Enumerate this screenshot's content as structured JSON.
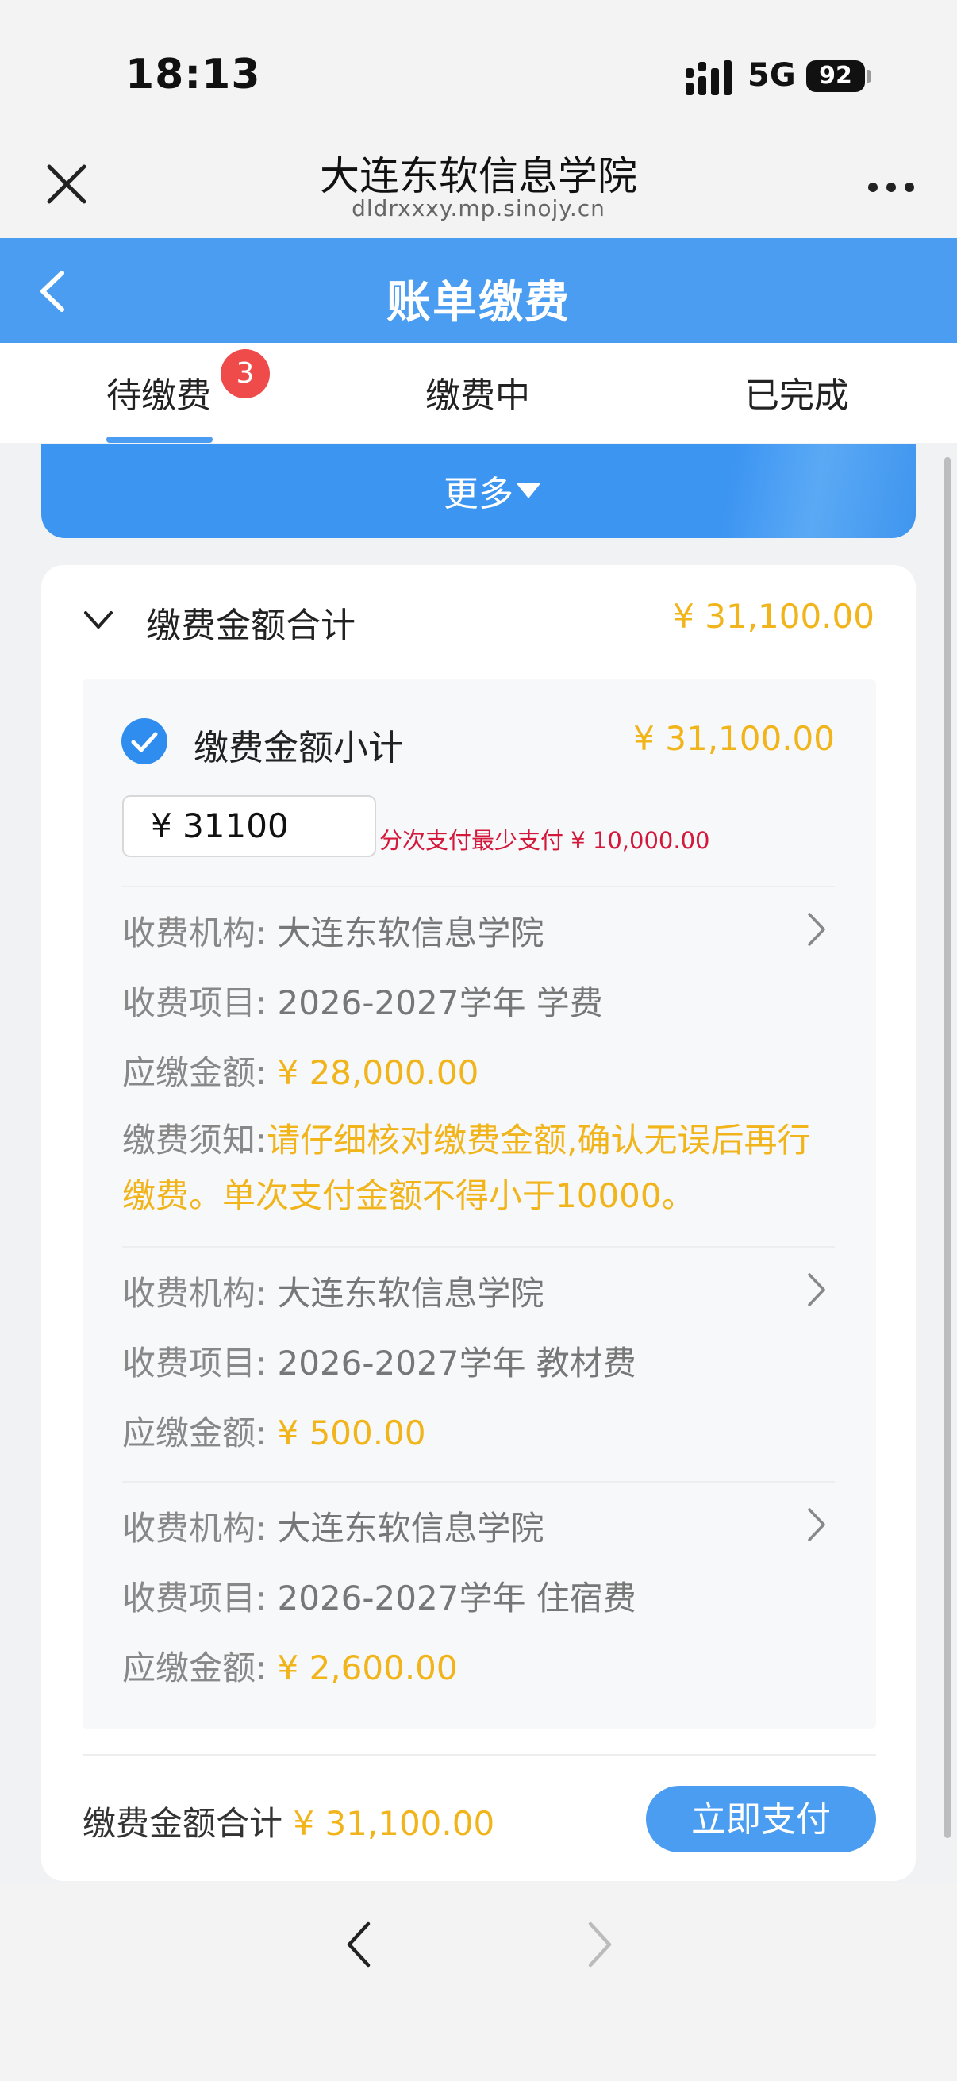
{
  "status_bar": {
    "time": "18:13",
    "network": "5G",
    "battery": "92",
    "signal_icon": "signal-bars-icon"
  },
  "browser": {
    "title": "大连东软信息学院",
    "url": "dldrxxxy.mp.sinojy.cn",
    "close_icon": "close-icon",
    "more_icon": "more-dots-icon"
  },
  "header": {
    "title": "账单缴费",
    "back_icon": "back-arrow-icon"
  },
  "tabs": [
    {
      "label": "待缴费",
      "badge": "3",
      "active": true
    },
    {
      "label": "缴费中",
      "active": false
    },
    {
      "label": "已完成",
      "active": false
    }
  ],
  "more_banner": {
    "label": "更多",
    "icon": "caret-down-icon"
  },
  "bill": {
    "total_label": "缴费金额合计",
    "total_amount": "¥ 31,100.00",
    "subtotal_label": "缴费金额小计",
    "subtotal_amount": "¥ 31,100.00",
    "input_value": "¥ 31100",
    "min_hint": "分次支付最少支付 ¥ 10,000.00",
    "items": [
      {
        "org_label": "收费机构:",
        "org": "大连东软信息学院",
        "item_label": "收费项目:",
        "item": "2026-2027学年 学费",
        "amount_label": "应缴金额:",
        "amount": "¥ 28,000.00",
        "notice_label": "缴费须知:",
        "notice": "请仔细核对缴费金额,确认无误后再行缴费。单次支付金额不得小于10000。"
      },
      {
        "org_label": "收费机构:",
        "org": "大连东软信息学院",
        "item_label": "收费项目:",
        "item": "2026-2027学年 教材费",
        "amount_label": "应缴金额:",
        "amount": "¥ 500.00"
      },
      {
        "org_label": "收费机构:",
        "org": "大连东软信息学院",
        "item_label": "收费项目:",
        "item": "2026-2027学年 住宿费",
        "amount_label": "应缴金额:",
        "amount": "¥ 2,600.00"
      }
    ]
  },
  "footer": {
    "total_label": "缴费金额合计",
    "total_amount": "¥ 31,100.00",
    "pay_label": "立即支付"
  },
  "colors": {
    "primary": "#4a9df0",
    "money": "#f1b41b",
    "hint": "#d4183b",
    "badge": "#ef4b4b"
  }
}
